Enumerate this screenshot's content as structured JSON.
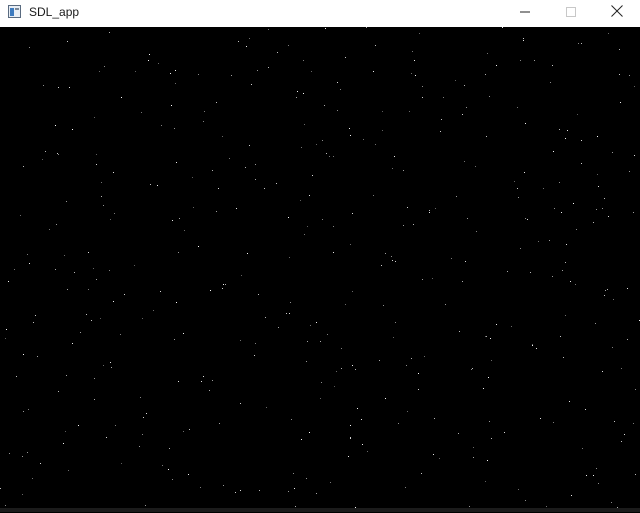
{
  "window": {
    "title": "SDL_app",
    "icon": "sdl-app-window-icon",
    "controls": {
      "minimize_icon": "minimize-icon",
      "maximize_icon": "maximize-icon",
      "close_icon": "close-icon"
    }
  },
  "canvas": {
    "background": "#000000",
    "star_color": "#ffffff",
    "content": "starfield"
  }
}
